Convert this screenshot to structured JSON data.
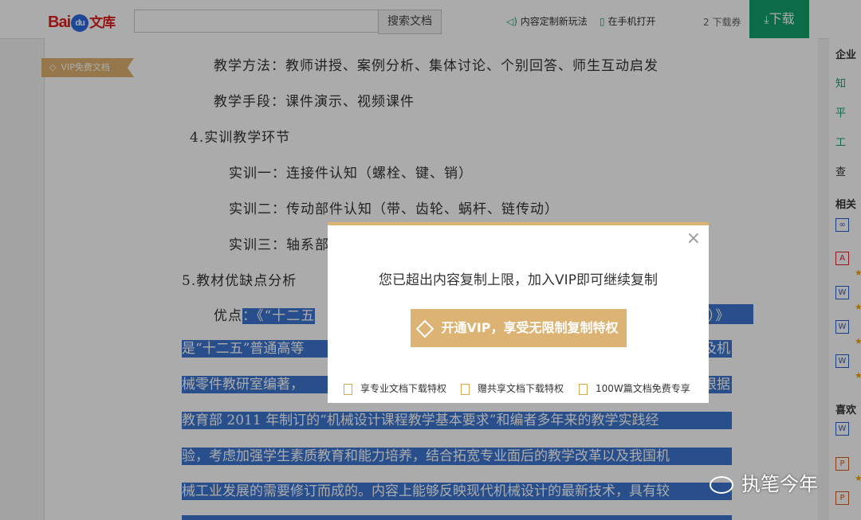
{
  "header": {
    "logo_text": "Bai",
    "logo_du": "du",
    "logo_wenku": "文库",
    "search_placeholder": "",
    "search_button": "搜索文档",
    "link_custom": "内容定制新玩法",
    "link_phone": "在手机打开",
    "download_count": "2 下载券",
    "download_button": "下载"
  },
  "badge": {
    "vip_free": "VIP免费文档"
  },
  "document": {
    "lines": [
      "教学方法：教师讲授、案例分析、集体讨论、个别回答、师生互动启发",
      "教学手段：课件演示、视频课件",
      "4.实训教学环节",
      "实训一：连接件认知（螺栓、键、销）",
      "实训二：传动部件认知（带、齿轮、蜗杆、链传动）",
      "实训三：轴系部",
      "5.教材优缺点分析"
    ],
    "adv_label": "优点",
    "highlighted": [
      "：《“十二五",
      "版）》",
      "是“十二五”普通高等",
      "及机",
      "械零件教研室编著，",
      "根据",
      "教育部 2011 年制订的“机械设计课程教学基本要求”和编者多年来的教学实践经",
      "验，考虑加强学生素质教育和能力培养，结合拓宽专业面后的教学改革以及我国机",
      "械工业发展的需要修订而成的。内容上能够反映现代机械设计的最新技术，具有较"
    ]
  },
  "sidebar": {
    "section1": "企业",
    "items1": [
      "知",
      "平",
      "工",
      "查"
    ],
    "section2": "相关",
    "section3": "喜欢"
  },
  "modal": {
    "close": "×",
    "title": "您已超出内容复制上限，加入VIP即可继续复制",
    "button": "开通VIP，享受无限制复制特权",
    "features": [
      "享专业文档下载特权",
      "赠共享文档下载特权",
      "100W篇文档免费专享"
    ]
  },
  "watermark": {
    "text": "执笔今年"
  },
  "colors": {
    "vip_gold": "#dcb373",
    "download_green": "#12a26c",
    "highlight_blue": "#3c77d1"
  }
}
